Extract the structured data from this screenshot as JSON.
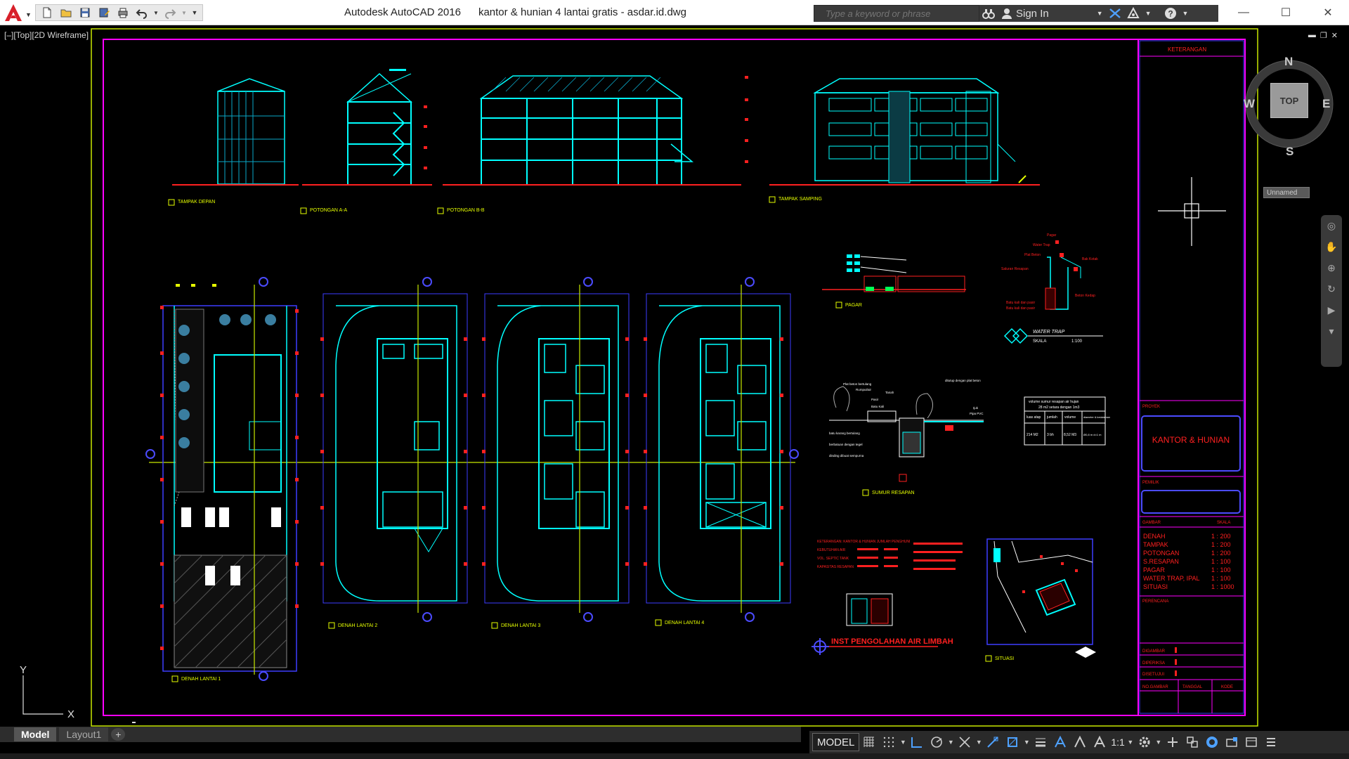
{
  "window": {
    "title": "Autodesk AutoCAD 2016      kantor & hunian 4 lantai gratis - asdar.id.dwg",
    "controls": {
      "minimize": "—",
      "maximize": "☐",
      "close": "✕"
    }
  },
  "search": {
    "placeholder": "Type a keyword or phrase"
  },
  "infobar": {
    "sign_in": "Sign In"
  },
  "viewport": {
    "label": "[–][Top][2D Wireframe]",
    "controls": {
      "minimize": "▬",
      "restore": "❐",
      "close": "✕"
    }
  },
  "viewcube": {
    "north": "N",
    "south": "S",
    "east": "E",
    "west": "W",
    "face": "TOP",
    "ucs_menu": "Unnamed"
  },
  "ucs": {
    "x": "X",
    "y": "Y"
  },
  "drawing": {
    "colors": {
      "border": "#c8e800",
      "frame": "#ff00ff",
      "inner": "#3d3dff",
      "primary": "#00ffff",
      "cyan_dark": "#0aa7c8",
      "red": "#ff2020",
      "yellow": "#e6ff00",
      "white": "#ffffff",
      "blue": "#4b4bff"
    },
    "elevation_labels": [
      "TAMPAK DEPAN",
      "POTONGAN A-A",
      "POTONGAN B-B",
      "TAMPAK SAMPING"
    ],
    "plan_labels": [
      "DENAH LANTAI 1",
      "DENAH LANTAI 2",
      "DENAH LANTAI 3",
      "DENAH LANTAI 4"
    ],
    "detail_labels": {
      "fence": "PAGAR",
      "water_trap": "WATER TRAP",
      "water_trap_scale_label": "SKALA",
      "water_trap_scale_value": "1:100",
      "infiltration": "SUMUR RESAPAN",
      "waste": "INST PENGOLAHAN AIR LIMBAH",
      "situation": "SITUASI"
    },
    "water_trap_notes": [
      "Pagar",
      "Water Trap",
      "Plat Beton",
      "Bak Kotak",
      "Saluran Resapan",
      "Batu kali dan pasir",
      "Batu kali dan pasir",
      "Beton Kedap"
    ],
    "resapan_notes": [
      "Plat beton bertulang",
      "Rumput/air",
      "Tanah",
      "Pasir",
      "Batu Kali",
      "Ijuk",
      "Pipa PVC",
      "ditutup dengan plat beton",
      "batu karang bertulang",
      "berbatuan dengan tegel",
      "dinding dibuat sempurna"
    ],
    "resapan_table": {
      "title": "volume sumur resapan air hujan",
      "subtitle": "28 m2 setara dengan 1m3",
      "headers": [
        "luas atap",
        "jumlah",
        "volume",
        "diameter & kedalaman"
      ],
      "row": [
        "214 M2",
        "3 bh",
        "8,52 M3",
        "Ø0,8 m d=1 m"
      ]
    },
    "waste_notes": [
      "KETERANGAN: KANTOR & HUNIAN JUMLAH PENGHUNI",
      "KEBUTUHAN AIR",
      "VOL. SEPTIC TANK",
      "KAPASITAS RESAPAN"
    ]
  },
  "title_block": {
    "keterangan": "KETERANGAN",
    "proyek_label": "PROYEK",
    "project_name": "KANTOR & HUNIAN",
    "pemilik_label": "PEMILIK",
    "gambar_label": "GAMBAR",
    "skala_label": "SKALA",
    "drawings": [
      {
        "name": "DENAH",
        "scale": "1 : 200"
      },
      {
        "name": "TAMPAK",
        "scale": "1 : 200"
      },
      {
        "name": "POTONGAN",
        "scale": "1 : 200"
      },
      {
        "name": "S.RESAPAN",
        "scale": "1 : 100"
      },
      {
        "name": "PAGAR",
        "scale": "1 : 100"
      },
      {
        "name": "WATER TRAP, IPAL",
        "scale": "1 : 100"
      },
      {
        "name": "SITUASI",
        "scale": "1 : 1000"
      }
    ],
    "perencana_label": "PERENCANA",
    "digambar_label": "DIGAMBAR",
    "diperiksa_label": "DIPERIKSA",
    "disetujui_label": "DISETUJUI",
    "no_gambar_label": "NO.GAMBAR",
    "tanggal_label": "TANGGAL",
    "kode_label": "KODE"
  },
  "layout_tabs": [
    {
      "label": "Model",
      "active": true
    },
    {
      "label": "Layout1",
      "active": false
    }
  ],
  "layout_add": "+",
  "statusbar": {
    "model": "MODEL",
    "scale": "1:1"
  }
}
